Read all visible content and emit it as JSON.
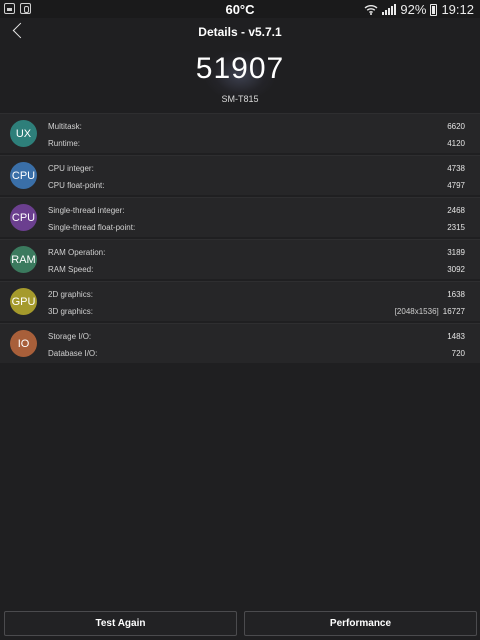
{
  "status_bar": {
    "temperature": "60°C",
    "battery_percent": "92%",
    "time": "19:12",
    "icons": [
      "gallery-icon",
      "clipboard-icon",
      "wifi-icon",
      "signal-icon",
      "battery-icon"
    ]
  },
  "header": {
    "title": "Details - v5.7.1",
    "back_icon": "chevron-left-icon"
  },
  "score": {
    "total": "51907",
    "device": "SM-T815"
  },
  "rows": [
    {
      "badge": "UX",
      "color": "#2e7f7a",
      "m1_label": "Multitask:",
      "m1_value": "6620",
      "m2_label": "Runtime:",
      "m2_value": "4120"
    },
    {
      "badge": "CPU",
      "color": "#3a6fa8",
      "m1_label": "CPU integer:",
      "m1_value": "4738",
      "m2_label": "CPU float-point:",
      "m2_value": "4797"
    },
    {
      "badge": "CPU",
      "color": "#6b3f8f",
      "m1_label": "Single-thread integer:",
      "m1_value": "2468",
      "m2_label": "Single-thread float-point:",
      "m2_value": "2315"
    },
    {
      "badge": "RAM",
      "color": "#3b7a5e",
      "m1_label": "RAM Operation:",
      "m1_value": "3189",
      "m2_label": "RAM Speed:",
      "m2_value": "3092"
    },
    {
      "badge": "GPU",
      "color": "#a59a2c",
      "m1_label": "2D graphics:",
      "m1_value": "1638",
      "m2_label": "3D graphics:",
      "m2_value": "16727",
      "m2_prefix": "[2048x1536]"
    },
    {
      "badge": "IO",
      "color": "#a85f3a",
      "m1_label": "Storage I/O:",
      "m1_value": "1483",
      "m2_label": "Database I/O:",
      "m2_value": "720"
    }
  ],
  "buttons": {
    "test_again": "Test Again",
    "performance": "Performance"
  }
}
